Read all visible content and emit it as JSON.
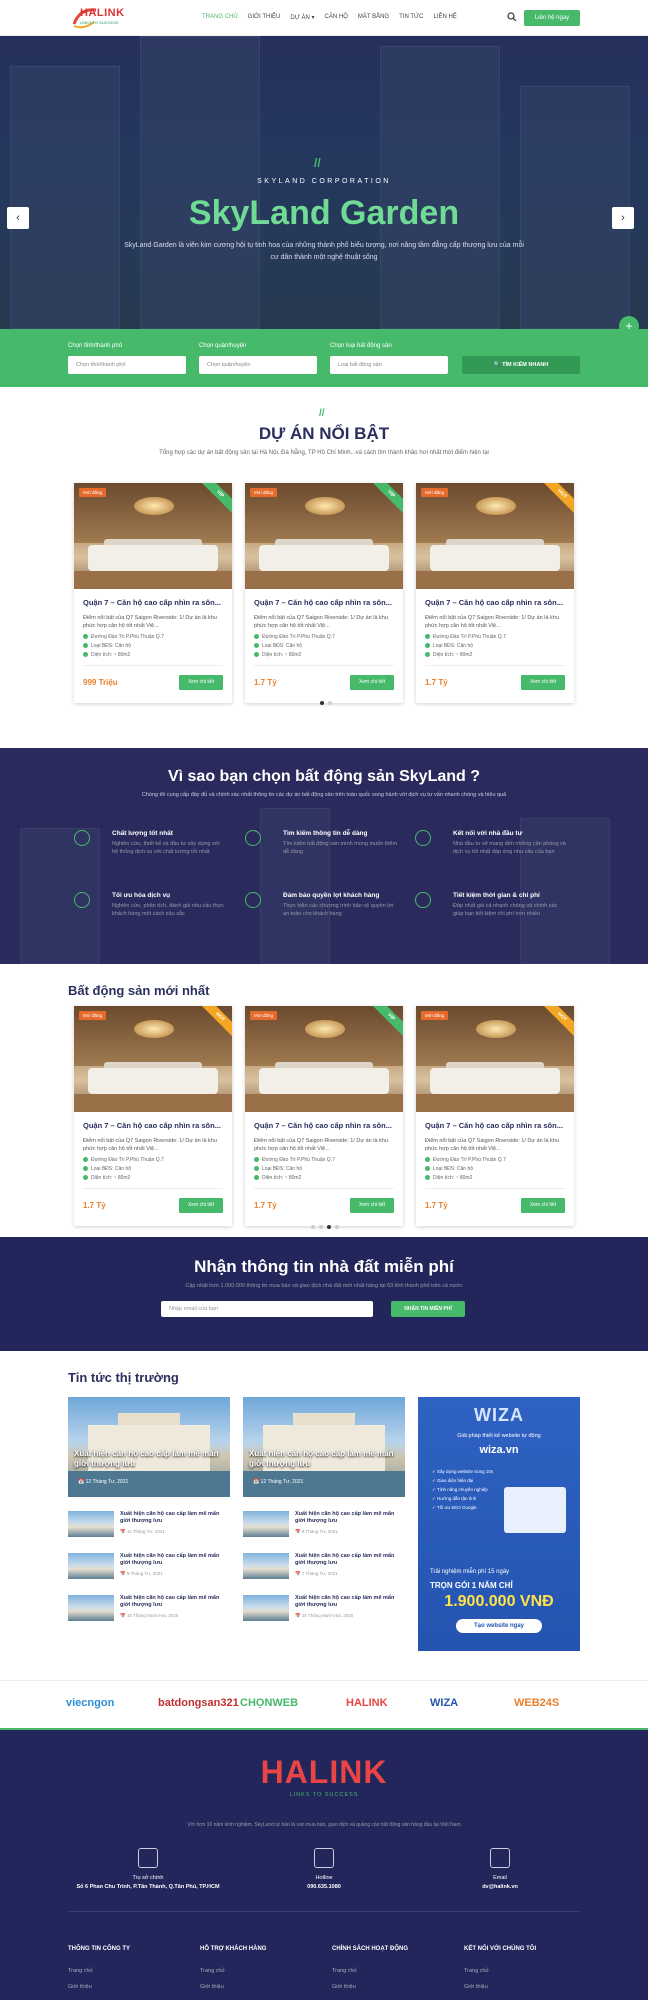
{
  "header": {
    "logo_text": "HALINK",
    "logo_sub": "LINKS TO SUCCESS",
    "nav": [
      "TRANG CHỦ",
      "GIỚI THIỆU",
      "DỰ ÁN ▾",
      "CĂN HỘ",
      "MẶT BẰNG",
      "TIN TỨC",
      "LIÊN HỆ"
    ],
    "contact_button": "Liên hệ ngay"
  },
  "hero": {
    "slash": "//",
    "corp": "SKYLAND CORPORATION",
    "title": "SkyLand Garden",
    "desc": "SkyLand Garden là viên kim cương hội tụ tinh hoa của những thành phố biểu tượng, nơi nâng tầm đẳng cấp thượng lưu của mỗi cư dân thành một nghệ thuật sống",
    "prev": "‹",
    "next": "›",
    "float": "+"
  },
  "filter": {
    "city_label": "Chọn tỉnh/thành phố",
    "city_placeholder": "Chọn tỉnh/thành phố",
    "district_label": "Chọn quận/huyện",
    "district_placeholder": "Chọn quận/huyện",
    "type_label": "Chọn loại bất động sản",
    "type_placeholder": "Loại bất động sản",
    "search_button": "TÌM KIẾM NHANH"
  },
  "featured": {
    "slash": "//",
    "title": "DỰ ÁN NỔI BẬT",
    "subtitle": "Tổng hợp các dự án bất động sản tại Hà Nội, Đà Nẵng, TP Hồ Chí Minh...và cách tìm thành khảo hơi nhất thời điểm hiện tại",
    "cards": [
      {
        "tag": "Mới đăng",
        "ribbon": "VIP",
        "ribbon_color": "#46b96a",
        "title": "Quận 7 – Căn hộ cao cấp nhìn ra sôn...",
        "desc": "Điểm nổi bật của Q7 Saigon Riverside: 1/ Dự án là khu phức hợp căn hộ tốt nhất Việ...",
        "address": "Đường Đào Trí P.Phú Thuận Q.7",
        "type": "Loại BĐS: Căn hộ",
        "area": "Diện tích: ~ 80m2",
        "price": "999 Triệu",
        "button": "Xem chi tiết"
      },
      {
        "tag": "Mới đăng",
        "ribbon": "VIP",
        "ribbon_color": "#46b96a",
        "title": "Quận 7 – Căn hộ cao cấp nhìn ra sôn...",
        "desc": "Điểm nổi bật của Q7 Saigon Riverside: 1/ Dự án là khu phức hợp căn hộ tốt nhất Việ...",
        "address": "Đường Đào Trí P.Phú Thuận Q.7",
        "type": "Loại BĐS: Căn hộ",
        "area": "Diện tích: ~ 80m2",
        "price": "1.7 Tỷ",
        "button": "Xem chi tiết"
      },
      {
        "tag": "Mới đăng",
        "ribbon": "HOT",
        "ribbon_color": "#f2a623",
        "title": "Quận 7 – Căn hộ cao cấp nhìn ra sôn...",
        "desc": "Điểm nổi bật của Q7 Saigon Riverside: 1/ Dự án là khu phức hợp căn hộ tốt nhất Việ...",
        "address": "Đường Đào Trí P.Phú Thuận Q.7",
        "type": "Loại BĐS: Căn hộ",
        "area": "Diện tích: ~ 80m2",
        "price": "1.7 Tỷ",
        "button": "Xem chi tiết"
      }
    ]
  },
  "why": {
    "title": "Vì sao bạn chọn bất động sản SkyLand ?",
    "subtitle": "Chúng tôi cung cấp đầy đủ và chính xác nhất thông tin các dự án bất động sản trên toàn quốc song hành với dịch vụ tư vấn nhanh chóng và hiệu quả",
    "features": [
      {
        "title": "Chất lượng tốt nhất",
        "desc": "Nghiên cứu, thiết kế và đầu tư xây dựng với hệ thống dịch vụ với chất lượng tốt nhất"
      },
      {
        "title": "Tìm kiếm thông tin dễ dàng",
        "desc": "Tìm kiếm bất động sản mình mong muốn thêm dễ dàng"
      },
      {
        "title": "Kết nối với nhà đầu tư",
        "desc": "Nhà đầu tư sẽ mang đến những căn phòng và dịch vụ tốt nhất đáp ứng nhu cầu của bạn"
      },
      {
        "title": "Tối ưu hóa dịch vụ",
        "desc": "Nghiên cứu, phân tích, đánh giá nhu cầu thực khách hàng một cách sâu sắc"
      },
      {
        "title": "Đảm bảo quyền lợi khách hàng",
        "desc": "Thực hiện các chương trình bảo vệ quyền lợi an toàn cho khách hàng"
      },
      {
        "title": "Tiết kiệm thời gian & chi phí",
        "desc": "Đáp nhất giá cả nhanh chóng và chính xác giúp bạn tiết kiệm chi phí hơn nhiều"
      }
    ]
  },
  "latest": {
    "title": "Bất động sản mới nhất",
    "cards": [
      {
        "tag": "Mới đăng",
        "ribbon": "HOT",
        "ribbon_color": "#f2a623",
        "title": "Quận 7 – Căn hộ cao cấp nhìn ra sôn...",
        "desc": "Điểm nổi bật của Q7 Saigon Riverside: 1/ Dự án là khu phức hợp căn hộ tốt nhất Việ...",
        "address": "Đường Đào Trí P.Phú Thuận Q.7",
        "type": "Loại BĐS: Căn hộ",
        "area": "Diện tích: ~ 80m2",
        "price": "1.7 Tỷ",
        "button": "Xem chi tiết"
      },
      {
        "tag": "Mới đăng",
        "ribbon": "VIP",
        "ribbon_color": "#46b96a",
        "title": "Quận 7 – Căn hộ cao cấp nhìn ra sôn...",
        "desc": "Điểm nổi bật của Q7 Saigon Riverside: 1/ Dự án là khu phức hợp căn hộ tốt nhất Việ...",
        "address": "Đường Đào Trí P.Phú Thuận Q.7",
        "type": "Loại BĐS: Căn hộ",
        "area": "Diện tích: ~ 80m2",
        "price": "1.7 Tỷ",
        "button": "Xem chi tiết"
      },
      {
        "tag": "Mới đăng",
        "ribbon": "HOT",
        "ribbon_color": "#f2a623",
        "title": "Quận 7 – Căn hộ cao cấp nhìn ra sôn...",
        "desc": "Điểm nổi bật của Q7 Saigon Riverside: 1/ Dự án là khu phức hợp căn hộ tốt nhất Việ...",
        "address": "Đường Đào Trí P.Phú Thuận Q.7",
        "type": "Loại BĐS: Căn hộ",
        "area": "Diện tích: ~ 80m2",
        "price": "1.7 Tỷ",
        "button": "Xem chi tiết"
      }
    ]
  },
  "newsletter": {
    "title": "Nhận thông tin nhà đất miễn phí",
    "subtitle": "Cập nhật hơn 1.000.000 thông tin mua bán và giao dịch nhà đất mới nhất hàng tại 63 tỉnh thành phố trên cả nước",
    "placeholder": "Nhập email của bạn",
    "button": "NHẬN TIN MIỄN PHÍ"
  },
  "market": {
    "title": "Tin tức thị trường",
    "big": [
      {
        "caption": "Xuất hiện căn hộ cao cấp làm mê mẩn giới thượng lưu",
        "date": "12 Tháng Tư, 2021"
      },
      {
        "caption": "Xuất hiện căn hộ cao cấp làm mê mẩn giới thượng lưu",
        "date": "12 Tháng Tư, 2021"
      }
    ],
    "small_left": [
      {
        "title": "Xuất hiện căn hộ cao cấp làm mê mẩn giới thượng lưu",
        "date": "11 Tháng Tư, 2021"
      },
      {
        "title": "Xuất hiện căn hộ cao cấp làm mê mẩn giới thượng lưu",
        "date": "9 Tháng Tư, 2021"
      },
      {
        "title": "Xuất hiện căn hộ cao cấp làm mê mẩn giới thượng lưu",
        "date": "15 Tháng Mười Hai, 2020"
      }
    ],
    "small_right": [
      {
        "title": "Xuất hiện căn hộ cao cấp làm mê mẩn giới thượng lưu",
        "date": "9 Tháng Tư, 2021"
      },
      {
        "title": "Xuất hiện căn hộ cao cấp làm mê mẩn giới thượng lưu",
        "date": "7 Tháng Tư, 2021"
      },
      {
        "title": "Xuất hiện căn hộ cao cấp làm mê mẩn giới thượng lưu",
        "date": "15 Tháng Mười Hai, 2020"
      }
    ]
  },
  "ad": {
    "logo": "WIZA",
    "line1": "Giải pháp thiết kế website tự động",
    "line2": "wiza.vn",
    "features": [
      "Xây dựng website trong 10s",
      "Giao diện hiện đại",
      "Tính năng chuyên nghiệp",
      "Hướng dẫn tận tình",
      "Tối ưu SEO Google"
    ],
    "trial": "Trải nghiệm miễn phí 15 ngày",
    "pack": "TRỌN GÓI 1 NĂM CHỈ",
    "price": "1.900.000 VNĐ",
    "button": "Tạo website ngay"
  },
  "partners": [
    "viecngon",
    "batdongsan321",
    "CHỌNWEB",
    "HALINK",
    "WIZA",
    "WEB24S"
  ],
  "footer": {
    "logo": "HALINK",
    "logo_sub": "LINKS TO SUCCESS",
    "desc": "Với hơn 10 năm kinh nghiệm, SkyLand tự hào là sàn mua bán, giao dịch và quảng cáo bất động sản hàng đầu tại Việt Nam",
    "office_label": "Trụ sở chính",
    "office_value": "Số 6 Phan Chu Trinh, P.Tân Thành, Q.Tân Phú, TP.HCM",
    "hotline_label": "Hotline",
    "hotline_value": "090.635.1080",
    "email_label": "Email",
    "email_value": "dv@halink.vn",
    "columns": [
      {
        "head": "THÔNG TIN CÔNG TY",
        "links": [
          "Trang chủ",
          "Giới thiệu"
        ]
      },
      {
        "head": "HỖ TRỢ KHÁCH HÀNG",
        "links": [
          "Trang chủ",
          "Giới thiệu"
        ]
      },
      {
        "head": "CHÍNH SÁCH HOẠT ĐỘNG",
        "links": [
          "Trang chủ",
          "Giới thiệu"
        ]
      },
      {
        "head": "KẾT NỐI VỚI CHÚNG TÔI",
        "links": [
          "Trang chủ",
          "Giới thiệu"
        ]
      }
    ]
  }
}
